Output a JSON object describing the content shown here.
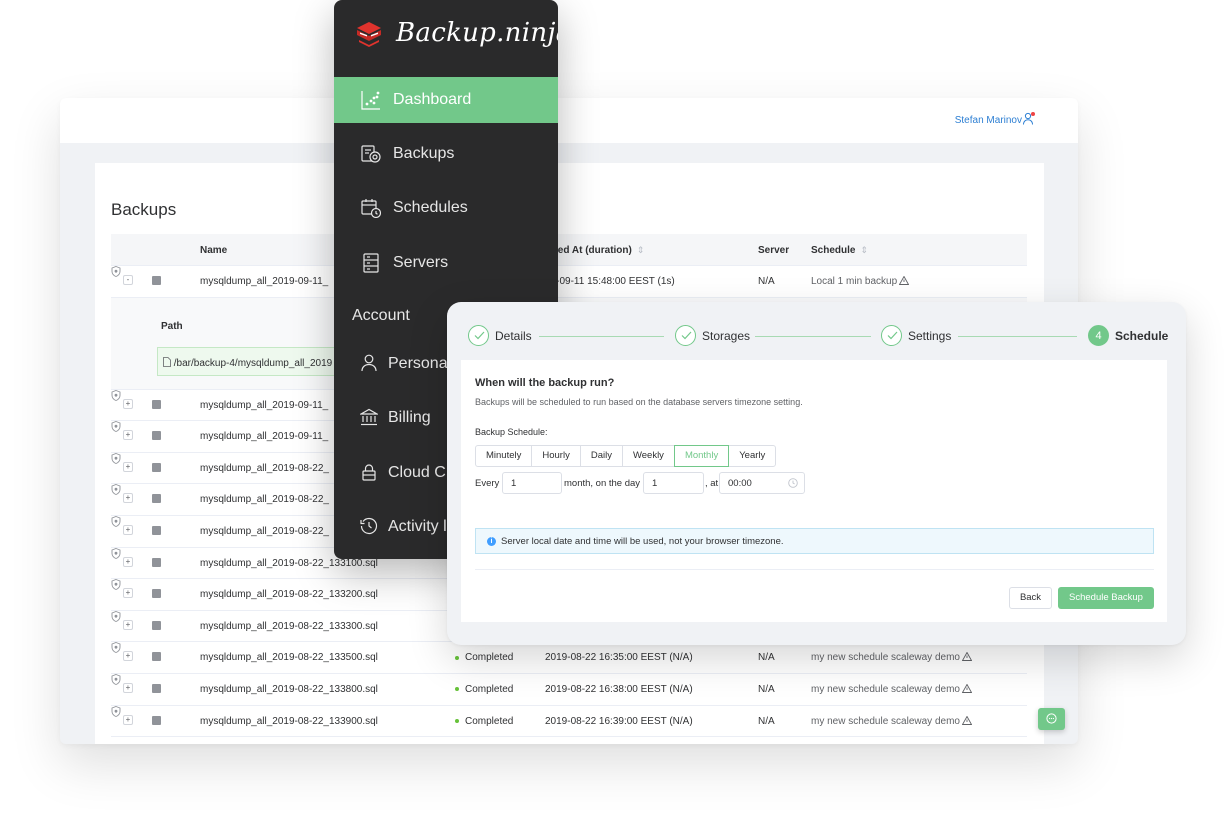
{
  "app": {
    "brand": "Backup.ninja"
  },
  "header": {
    "user_name": "Stefan Marinov"
  },
  "sidebar": {
    "items": [
      {
        "label": "Dashboard",
        "icon": "dashboard-icon",
        "active": true
      },
      {
        "label": "Backups",
        "icon": "backups-icon"
      },
      {
        "label": "Schedules",
        "icon": "schedules-icon"
      },
      {
        "label": "Servers",
        "icon": "servers-icon"
      }
    ],
    "account_heading": "Account",
    "account_items": [
      {
        "label": "Persona",
        "icon": "person-icon"
      },
      {
        "label": "Billing",
        "icon": "bank-icon"
      },
      {
        "label": "Cloud C",
        "icon": "lock-icon"
      },
      {
        "label": "Activity l",
        "icon": "history-icon"
      }
    ]
  },
  "backups": {
    "title": "Backups",
    "columns": {
      "name": "Name",
      "started": "arted At (duration)",
      "server": "Server",
      "schedule": "Schedule"
    },
    "expanded": {
      "path_label": "Path",
      "path_value": "/bar/backup-4/mysqldump_all_2019"
    },
    "rows": [
      {
        "toggle": "-",
        "name": "mysqldump_all_2019-09-11_",
        "status": "",
        "time": "19-09-11 15:48:00 EEST (1s)",
        "server": "N/A",
        "schedule": "Local 1 min backup"
      },
      {
        "toggle": "+",
        "name": "mysqldump_all_2019-09-11_",
        "status": "",
        "time": "",
        "server": "",
        "schedule": ""
      },
      {
        "toggle": "+",
        "name": "mysqldump_all_2019-09-11_",
        "status": "",
        "time": "",
        "server": "",
        "schedule": ""
      },
      {
        "toggle": "+",
        "name": "mysqldump_all_2019-08-22_",
        "status": "",
        "time": "",
        "server": "",
        "schedule": ""
      },
      {
        "toggle": "+",
        "name": "mysqldump_all_2019-08-22_",
        "status": "",
        "time": "",
        "server": "",
        "schedule": ""
      },
      {
        "toggle": "+",
        "name": "mysqldump_all_2019-08-22_",
        "status": "",
        "time": "",
        "server": "",
        "schedule": ""
      },
      {
        "toggle": "+",
        "name": "mysqldump_all_2019-08-22_133100.sql",
        "status": "",
        "time": "",
        "server": "",
        "schedule": ""
      },
      {
        "toggle": "+",
        "name": "mysqldump_all_2019-08-22_133200.sql",
        "status": "",
        "time": "",
        "server": "",
        "schedule": ""
      },
      {
        "toggle": "+",
        "name": "mysqldump_all_2019-08-22_133300.sql",
        "status": "",
        "time": "",
        "server": "",
        "schedule": ""
      },
      {
        "toggle": "+",
        "name": "mysqldump_all_2019-08-22_133500.sql",
        "status": "Completed",
        "time": "2019-08-22 16:35:00 EEST (N/A)",
        "server": "N/A",
        "schedule": "my new schedule scaleway demo"
      },
      {
        "toggle": "+",
        "name": "mysqldump_all_2019-08-22_133800.sql",
        "status": "Completed",
        "time": "2019-08-22 16:38:00 EEST (N/A)",
        "server": "N/A",
        "schedule": "my new schedule scaleway demo"
      },
      {
        "toggle": "+",
        "name": "mysqldump_all_2019-08-22_133900.sql",
        "status": "Completed",
        "time": "2019-08-22 16:39:00 EEST (N/A)",
        "server": "N/A",
        "schedule": "my new schedule scaleway demo"
      }
    ]
  },
  "wizard": {
    "steps": [
      {
        "label": "Details",
        "state": "done"
      },
      {
        "label": "Storages",
        "state": "done"
      },
      {
        "label": "Settings",
        "state": "done"
      },
      {
        "label": "Schedule",
        "number": "4",
        "state": "current"
      }
    ],
    "question": "When will the backup run?",
    "description": "Backups will be scheduled to run based on the database servers timezone setting.",
    "schedule_label": "Backup Schedule:",
    "frequencies": [
      "Minutely",
      "Hourly",
      "Daily",
      "Weekly",
      "Monthly",
      "Yearly"
    ],
    "selected_frequency": "Monthly",
    "every_label": "Every",
    "every_value": "1",
    "month_label": "month, on the day",
    "day_value": "1",
    "at_label": ", at",
    "time_value": "00:00",
    "info": "Server local date and time will be used, not your browser timezone.",
    "back_label": "Back",
    "submit_label": "Schedule Backup"
  },
  "colors": {
    "accent": "#72c88a",
    "sidebar_bg": "#2a2a2b",
    "link": "#2d7fd3",
    "info_bg": "#eef8fd"
  }
}
